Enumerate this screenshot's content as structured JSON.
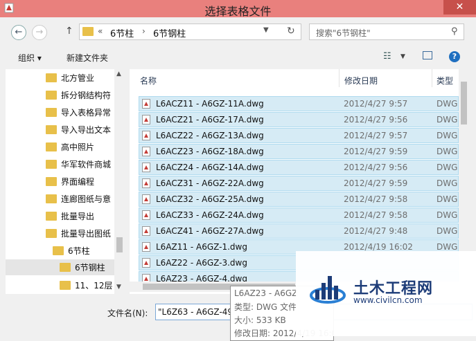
{
  "window": {
    "title": "选择表格文件",
    "close_glyph": "✕"
  },
  "nav": {
    "back_glyph": "←",
    "forward_glyph": "→",
    "up_glyph": "↑",
    "refresh_glyph": "↻"
  },
  "address": {
    "overflow": "«",
    "separator": "›",
    "crumbs": [
      "6节柱",
      "6节钢柱"
    ]
  },
  "search": {
    "placeholder": "搜索\"6节钢柱\""
  },
  "toolbar": {
    "organize": "组织 ▾",
    "new_folder": "新建文件夹",
    "help": "?"
  },
  "sidebar": {
    "items": [
      {
        "label": "北方管业"
      },
      {
        "label": "拆分钢结构符"
      },
      {
        "label": "导入表格异常"
      },
      {
        "label": "导入导出文本"
      },
      {
        "label": "高中照片"
      },
      {
        "label": "华军软件商城"
      },
      {
        "label": "界面编程"
      },
      {
        "label": "连廊图纸与意"
      },
      {
        "label": "批量导出"
      },
      {
        "label": "批量导出图纸"
      },
      {
        "label": "6节柱"
      },
      {
        "label": "6节钢柱"
      },
      {
        "label": "11、12层"
      }
    ]
  },
  "columns": {
    "name": "名称",
    "date": "修改日期",
    "type": "类型"
  },
  "files": [
    {
      "name": "L6ACZ11 - A6GZ-11A.dwg",
      "date": "2012/4/27 9:57",
      "type": "DWG"
    },
    {
      "name": "L6ACZ21 - A6GZ-17A.dwg",
      "date": "2012/4/27 9:56",
      "type": "DWG"
    },
    {
      "name": "L6ACZ22 - A6GZ-13A.dwg",
      "date": "2012/4/27 9:57",
      "type": "DWG"
    },
    {
      "name": "L6ACZ23 - A6GZ-18A.dwg",
      "date": "2012/4/27 9:59",
      "type": "DWG"
    },
    {
      "name": "L6ACZ24 - A6GZ-14A.dwg",
      "date": "2012/4/27 9:56",
      "type": "DWG"
    },
    {
      "name": "L6ACZ31 - A6GZ-22A.dwg",
      "date": "2012/4/27 9:59",
      "type": "DWG"
    },
    {
      "name": "L6ACZ32 - A6GZ-25A.dwg",
      "date": "2012/4/27 9:58",
      "type": "DWG"
    },
    {
      "name": "L6ACZ33 - A6GZ-24A.dwg",
      "date": "2012/4/27 9:58",
      "type": "DWG"
    },
    {
      "name": "L6ACZ41 - A6GZ-27A.dwg",
      "date": "2012/4/27 9:48",
      "type": "DWG"
    },
    {
      "name": "L6AZ11 - A6GZ-1.dwg",
      "date": "2012/4/19 16:02",
      "type": "DWG"
    },
    {
      "name": "L6AZ22 - A6GZ-3.dwg",
      "date": "",
      "type": ""
    },
    {
      "name": "L6AZ23 - A6GZ-4.dwg",
      "date": "",
      "type": ""
    }
  ],
  "filename": {
    "label": "文件名(N):",
    "value": "\"L6Z63 - A6GZ-49.dwg\" \"L6AC"
  },
  "tooltip": {
    "name": "L6AZ23 - A6GZ",
    "type": "类型: DWG 文件",
    "size": "大小: 533 KB",
    "modified": "修改日期: 2012/4/19 16:02"
  },
  "watermark": {
    "title": "土木工程网",
    "url": "www.civilcn.com"
  },
  "colors": {
    "titlebar": "#e9807d",
    "selection": "#d6ebf5",
    "folder": "#e8c04a"
  }
}
